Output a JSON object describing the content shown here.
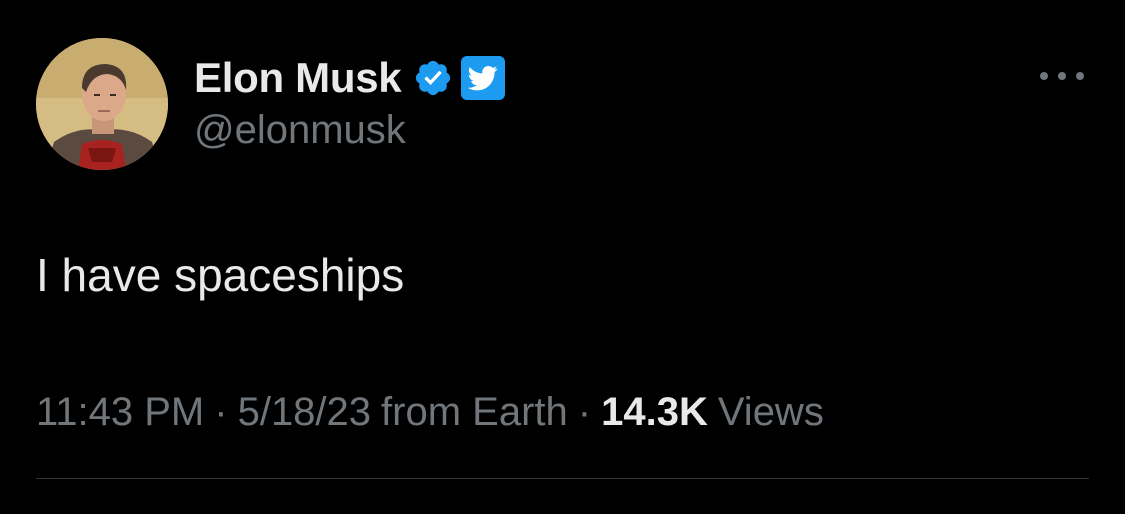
{
  "author": {
    "display_name": "Elon Musk",
    "handle": "@elonmusk",
    "avatar_icon": "profile-photo",
    "verified_icon": "verified-badge-icon",
    "affiliate_icon": "twitter-bird-icon"
  },
  "tweet": {
    "text": "I have spaceships"
  },
  "meta": {
    "time": "11:43 PM",
    "date": "5/18/23",
    "source": "from Earth",
    "views_count": "14.3K",
    "views_label": "Views",
    "separator": "·"
  },
  "more_icon": "more-options-icon",
  "colors": {
    "background": "#000000",
    "primary_text": "#e7e9ea",
    "secondary_text": "#71767b",
    "accent": "#1d9bf0",
    "divider": "#2f3336"
  }
}
